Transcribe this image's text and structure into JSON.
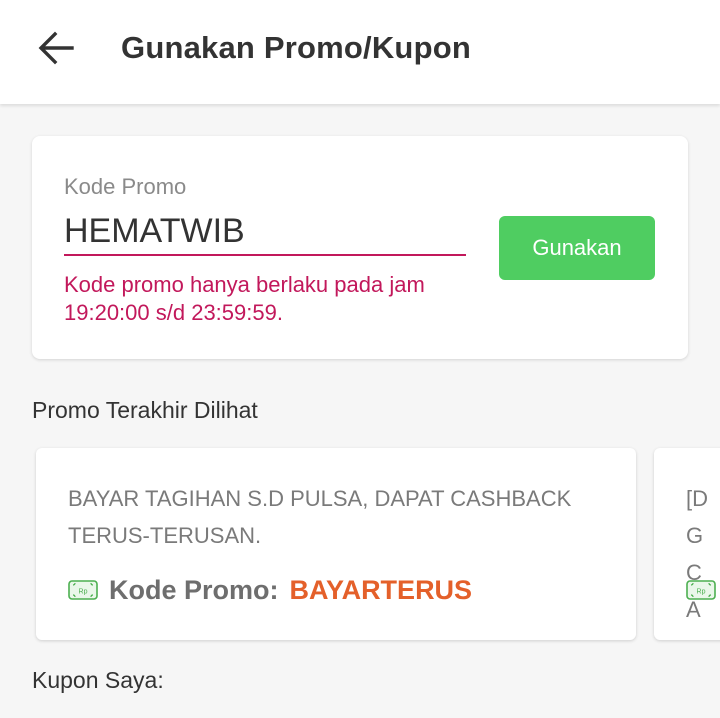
{
  "header": {
    "title": "Gunakan Promo/Kupon"
  },
  "promo_form": {
    "label": "Kode Promo",
    "value": "HEMATWIB",
    "error": "Kode promo hanya berlaku pada jam 19:20:00 s/d 23:59:59.",
    "apply_label": "Gunakan"
  },
  "recent": {
    "title": "Promo Terakhir Dilihat",
    "items": [
      {
        "description": "BAYAR TAGIHAN S.D PULSA, DAPAT CASHBACK TERUS-TERUSAN.",
        "code_label": "Kode Promo:",
        "code": "BAYARTERUS"
      },
      {
        "description": "[DG CA"
      }
    ]
  },
  "coupons": {
    "title": "Kupon Saya:"
  },
  "colors": {
    "accent_green": "#4fcd61",
    "error_pink": "#c2185b",
    "promo_orange": "#e4602a"
  },
  "icons": {
    "back": "arrow-left-icon",
    "ticket": "money-bill-icon"
  }
}
